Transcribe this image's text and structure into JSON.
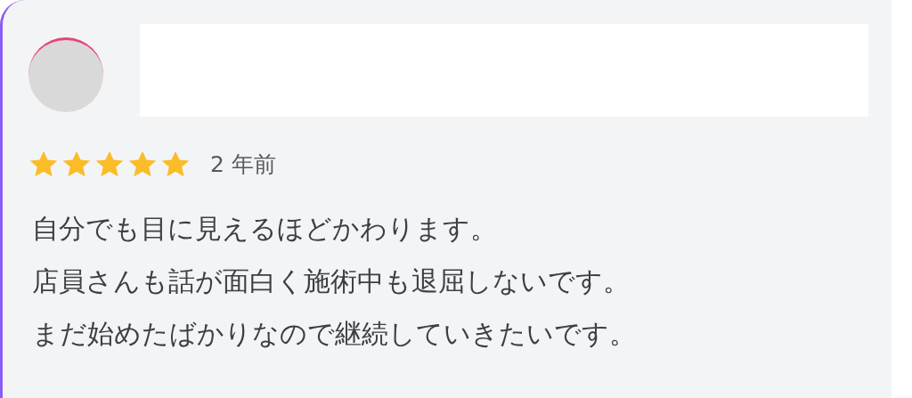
{
  "review": {
    "stars": 5,
    "time": "2 年前",
    "lines": [
      "自分でも目に見えるほどかわります。",
      "店員さんも話が面白く施術中も退屈しないです。",
      "まだ始めたばかりなので継続していきたいです。"
    ]
  }
}
